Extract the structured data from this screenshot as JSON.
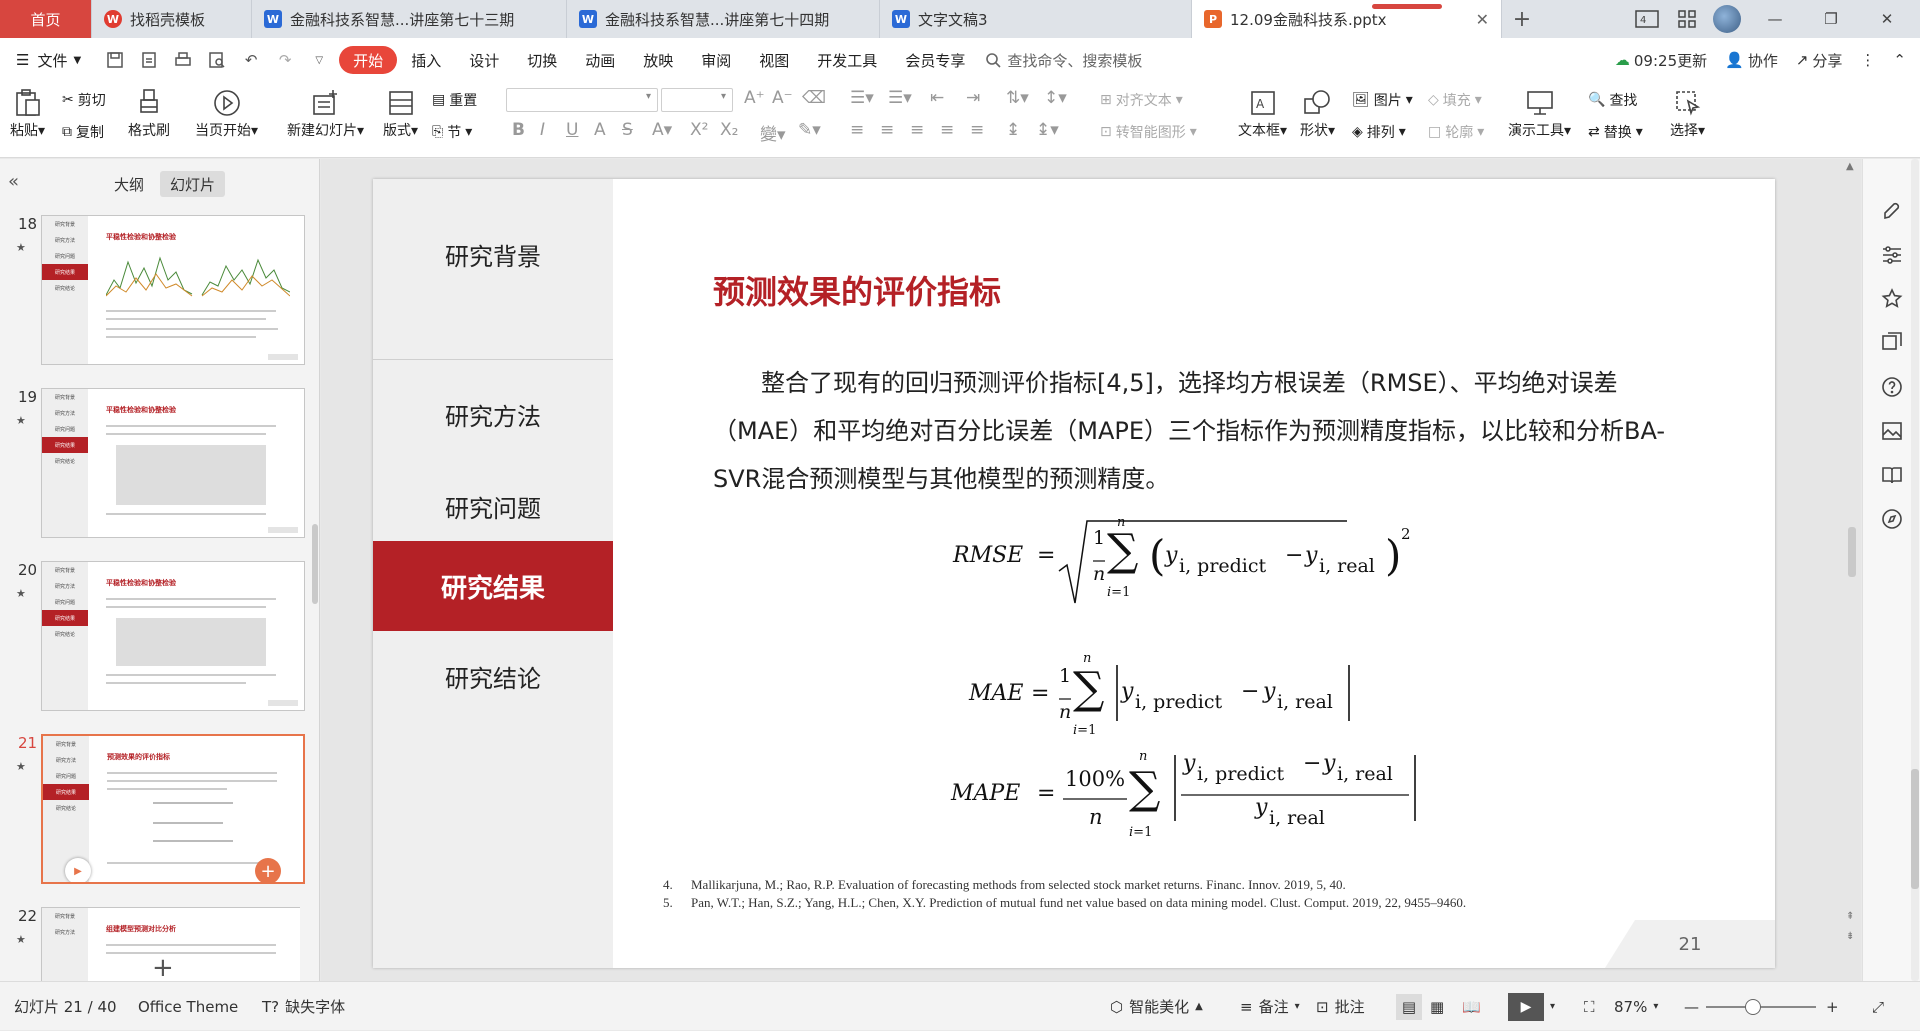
{
  "tabs": [
    {
      "label": "首页"
    },
    {
      "label": "找稻壳模板",
      "icon": "daoke-icon"
    },
    {
      "label": "金融科技系智慧...讲座第七十三期",
      "icon": "word-icon"
    },
    {
      "label": "金融科技系智慧...讲座第七十四期",
      "icon": "word-icon"
    },
    {
      "label": "文字文稿3",
      "icon": "word-icon"
    },
    {
      "label": "12.09金融科技系.pptx",
      "icon": "ppt-icon"
    }
  ],
  "menu": {
    "file": "文件",
    "items": [
      "开始",
      "插入",
      "设计",
      "切换",
      "动画",
      "放映",
      "审阅",
      "视图",
      "开发工具",
      "会员专享"
    ],
    "search": "查找命令、搜索模板",
    "update_time": "09:25更新",
    "collab": "协作",
    "share": "分享"
  },
  "ribbon": {
    "paste": "粘贴",
    "cut": "剪切",
    "copy": "复制",
    "format_painter": "格式刷",
    "from_current": "当页开始",
    "new_slide": "新建幻灯片",
    "layout": "版式",
    "reset": "重置",
    "section": "节",
    "align_text": "对齐文本",
    "smartart": "转智能图形",
    "textbox": "文本框",
    "shape": "形状",
    "picture": "图片",
    "arrange": "排列",
    "fill": "填充",
    "outline": "轮廓",
    "present_tools": "演示工具",
    "find": "查找",
    "replace": "替换",
    "select": "选择"
  },
  "left_panel": {
    "tab_outline": "大纲",
    "tab_slides": "幻灯片",
    "slides": [
      {
        "num": "18",
        "title": "平稳性检验和协整检验"
      },
      {
        "num": "19",
        "title": "平稳性检验和协整检验"
      },
      {
        "num": "20",
        "title": "平稳性检验和协整检验"
      },
      {
        "num": "21",
        "title": "预测效果的评价指标"
      },
      {
        "num": "22",
        "title": "组建模型预测对比分析"
      }
    ],
    "thumb_nav": [
      "研究背景",
      "研究方法",
      "研究问题",
      "研究结果",
      "研究结论"
    ]
  },
  "slide": {
    "nav": [
      "研究背景",
      "研究方法",
      "研究问题",
      "研究结果",
      "研究结论"
    ],
    "title": "预测效果的评价指标",
    "body": "整合了现有的回归预测评价指标[4,5]，选择均方根误差（RMSE）、平均绝对误差（MAE）和平均绝对百分比误差（MAPE）三个指标作为预测精度指标，以比较和分析BA-SVR混合预测模型与其他模型的预测精度。",
    "formulas": {
      "rmse_lhs": "RMSE",
      "mae_lhs": "MAE",
      "mape_lhs": "MAPE",
      "sub_predict": "i, predict",
      "sub_real": "i, real",
      "percent": "100%"
    },
    "refs": [
      {
        "n": "4.",
        "text": "Mallikarjuna, M.; Rao, R.P. Evaluation of forecasting methods from selected stock market returns. Financ. Innov. 2019, 5, 40."
      },
      {
        "n": "5.",
        "text": "Pan, W.T.; Han, S.Z.; Yang, H.L.; Chen, X.Y. Prediction of mutual fund net value based on data mining model. Clust. Comput. 2019, 22, 9455–9460."
      }
    ],
    "page": "21"
  },
  "status": {
    "slide_pos": "幻灯片 21 / 40",
    "theme": "Office Theme",
    "missing_font": "缺失字体",
    "beautify": "智能美化",
    "notes": "备注",
    "comments": "批注",
    "zoom": "87%",
    "zoom_level": 0.87
  }
}
